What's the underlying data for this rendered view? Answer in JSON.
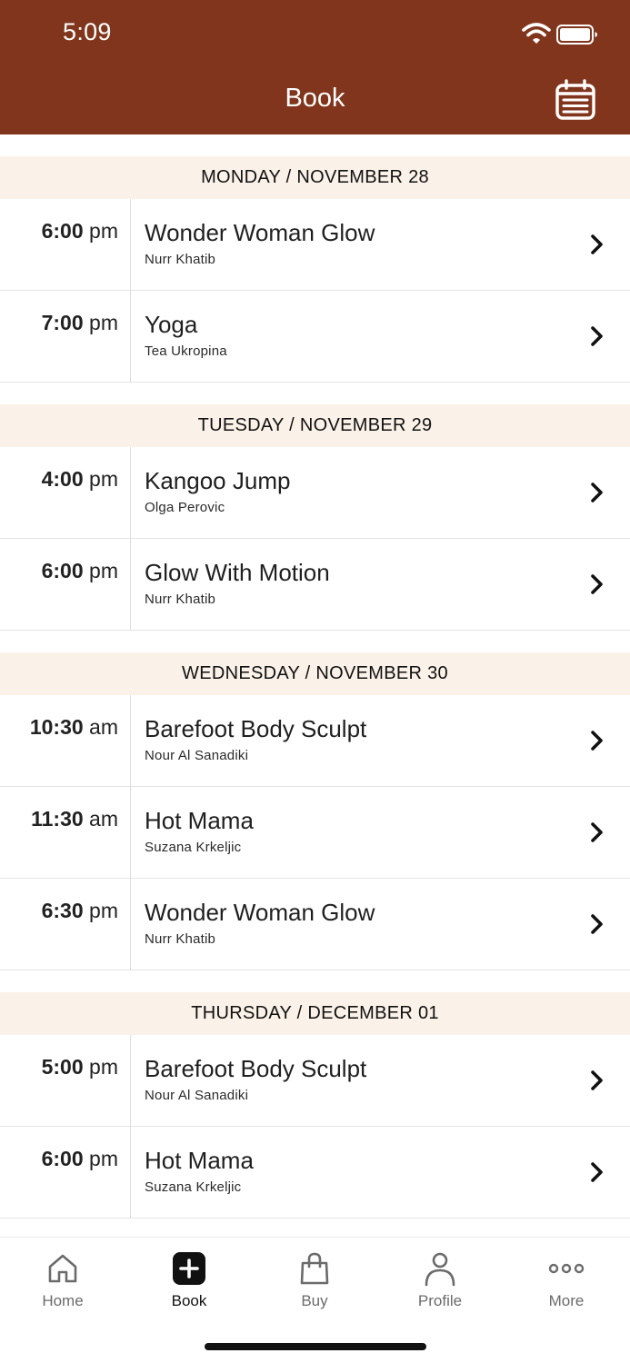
{
  "status_bar": {
    "time": "5:09"
  },
  "header": {
    "title": "Book"
  },
  "days": [
    {
      "label": "MONDAY / NOVEMBER 28",
      "classes": [
        {
          "time": "6:00",
          "period": "pm",
          "name": "Wonder Woman Glow",
          "instructor": "Nurr Khatib"
        },
        {
          "time": "7:00",
          "period": "pm",
          "name": "Yoga",
          "instructor": "Tea Ukropina"
        }
      ]
    },
    {
      "label": "TUESDAY / NOVEMBER 29",
      "classes": [
        {
          "time": "4:00",
          "period": "pm",
          "name": "Kangoo Jump",
          "instructor": "Olga Perovic"
        },
        {
          "time": "6:00",
          "period": "pm",
          "name": "Glow With Motion",
          "instructor": "Nurr Khatib"
        }
      ]
    },
    {
      "label": "WEDNESDAY / NOVEMBER 30",
      "classes": [
        {
          "time": "10:30",
          "period": "am",
          "name": "Barefoot Body Sculpt",
          "instructor": "Nour Al Sanadiki"
        },
        {
          "time": "11:30",
          "period": "am",
          "name": "Hot Mama",
          "instructor": "Suzana Krkeljic"
        },
        {
          "time": "6:30",
          "period": "pm",
          "name": "Wonder Woman Glow",
          "instructor": "Nurr Khatib"
        }
      ]
    },
    {
      "label": "THURSDAY / DECEMBER 01",
      "classes": [
        {
          "time": "5:00",
          "period": "pm",
          "name": "Barefoot Body Sculpt",
          "instructor": "Nour Al Sanadiki"
        },
        {
          "time": "6:00",
          "period": "pm",
          "name": "Hot Mama",
          "instructor": "Suzana Krkeljic"
        }
      ]
    }
  ],
  "tab_bar": {
    "tabs": [
      {
        "label": "Home",
        "icon": "home-icon",
        "active": false
      },
      {
        "label": "Book",
        "icon": "plus-square-icon",
        "active": true
      },
      {
        "label": "Buy",
        "icon": "shopping-bag-icon",
        "active": false
      },
      {
        "label": "Profile",
        "icon": "person-icon",
        "active": false
      },
      {
        "label": "More",
        "icon": "more-dots-icon",
        "active": false
      }
    ]
  },
  "colors": {
    "header_bg": "#81351c",
    "day_header_bg": "#faf2e8",
    "active_tab": "#111111",
    "inactive_tab": "#6b6b6b"
  }
}
